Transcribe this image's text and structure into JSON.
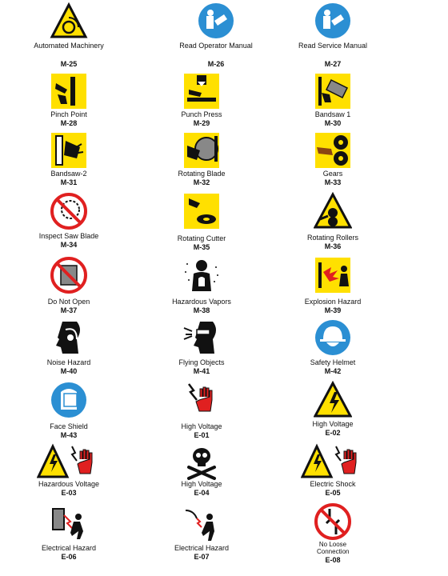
{
  "signs": [
    {
      "label": "Automated Machinery",
      "code": "M-25",
      "icon": "automated-machinery-icon"
    },
    {
      "label": "Read Operator Manual",
      "code": "M-26",
      "icon": "read-manual-icon"
    },
    {
      "label": "Read Service Manual",
      "code": "M-27",
      "icon": "read-manual-icon"
    },
    {
      "label": "Pinch Point",
      "code": "M-28",
      "icon": "pinch-point-icon"
    },
    {
      "label": "Punch Press",
      "code": "M-29",
      "icon": "punch-press-icon"
    },
    {
      "label": "Bandsaw 1",
      "code": "M-30",
      "icon": "bandsaw-icon"
    },
    {
      "label": "Bandsaw-2",
      "code": "M-31",
      "icon": "bandsaw-icon"
    },
    {
      "label": "Rotating Blade",
      "code": "M-32",
      "icon": "rotating-blade-icon"
    },
    {
      "label": "Gears",
      "code": "M-33",
      "icon": "gears-icon"
    },
    {
      "label": "Inspect Saw Blade",
      "code": "M-34",
      "icon": "inspect-saw-blade-icon"
    },
    {
      "label": "Rotating Cutter",
      "code": "M-35",
      "icon": "rotating-cutter-icon"
    },
    {
      "label": "Rotating Rollers",
      "code": "M-36",
      "icon": "rotating-rollers-icon"
    },
    {
      "label": "Do Not Open",
      "code": "M-37",
      "icon": "do-not-open-icon"
    },
    {
      "label": "Hazardous Vapors",
      "code": "M-38",
      "icon": "hazardous-vapors-icon"
    },
    {
      "label": "Explosion Hazard",
      "code": "M-39",
      "icon": "explosion-hazard-icon"
    },
    {
      "label": "Noise Hazard",
      "code": "M-40",
      "icon": "noise-hazard-icon"
    },
    {
      "label": "Flying Objects",
      "code": "M-41",
      "icon": "flying-objects-icon"
    },
    {
      "label": "Safety Helmet",
      "code": "M-42",
      "icon": "safety-helmet-icon"
    },
    {
      "label": "Face Shield",
      "code": "M-43",
      "icon": "face-shield-icon"
    },
    {
      "label": "High Voltage",
      "code": "E-01",
      "icon": "high-voltage-hand-icon"
    },
    {
      "label": "High Voltage",
      "code": "E-02",
      "icon": "high-voltage-triangle-icon"
    },
    {
      "label": "Hazardous Voltage",
      "code": "E-03",
      "icon": "hazardous-voltage-icon"
    },
    {
      "label": "High Voltage",
      "code": "E-04",
      "icon": "skull-crossbones-icon"
    },
    {
      "label": "Electric Shock",
      "code": "E-05",
      "icon": "electric-shock-icon"
    },
    {
      "label": "Electrical Hazard",
      "code": "E-06",
      "icon": "electrical-hazard-icon"
    },
    {
      "label": "Electrical Hazard",
      "code": "E-07",
      "icon": "electrical-hazard-person-icon"
    },
    {
      "label": "No Loose Connection",
      "code": "E-08",
      "icon": "no-loose-connection-icon"
    }
  ],
  "colors": {
    "yellow": "#ffe000",
    "blue": "#2b8fd3",
    "red": "#e02020",
    "black": "#111111"
  }
}
